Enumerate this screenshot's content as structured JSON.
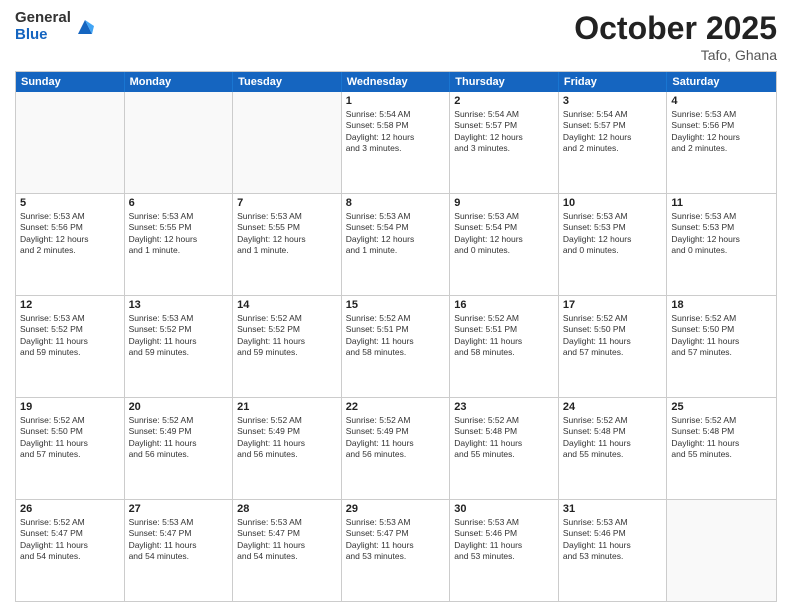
{
  "logo": {
    "general": "General",
    "blue": "Blue"
  },
  "header": {
    "month": "October 2025",
    "location": "Tafo, Ghana"
  },
  "weekdays": [
    "Sunday",
    "Monday",
    "Tuesday",
    "Wednesday",
    "Thursday",
    "Friday",
    "Saturday"
  ],
  "rows": [
    [
      {
        "day": "",
        "empty": true
      },
      {
        "day": "",
        "empty": true
      },
      {
        "day": "",
        "empty": true
      },
      {
        "day": "1",
        "info": "Sunrise: 5:54 AM\nSunset: 5:58 PM\nDaylight: 12 hours\nand 3 minutes."
      },
      {
        "day": "2",
        "info": "Sunrise: 5:54 AM\nSunset: 5:57 PM\nDaylight: 12 hours\nand 3 minutes."
      },
      {
        "day": "3",
        "info": "Sunrise: 5:54 AM\nSunset: 5:57 PM\nDaylight: 12 hours\nand 2 minutes."
      },
      {
        "day": "4",
        "info": "Sunrise: 5:53 AM\nSunset: 5:56 PM\nDaylight: 12 hours\nand 2 minutes."
      }
    ],
    [
      {
        "day": "5",
        "info": "Sunrise: 5:53 AM\nSunset: 5:56 PM\nDaylight: 12 hours\nand 2 minutes."
      },
      {
        "day": "6",
        "info": "Sunrise: 5:53 AM\nSunset: 5:55 PM\nDaylight: 12 hours\nand 1 minute."
      },
      {
        "day": "7",
        "info": "Sunrise: 5:53 AM\nSunset: 5:55 PM\nDaylight: 12 hours\nand 1 minute."
      },
      {
        "day": "8",
        "info": "Sunrise: 5:53 AM\nSunset: 5:54 PM\nDaylight: 12 hours\nand 1 minute."
      },
      {
        "day": "9",
        "info": "Sunrise: 5:53 AM\nSunset: 5:54 PM\nDaylight: 12 hours\nand 0 minutes."
      },
      {
        "day": "10",
        "info": "Sunrise: 5:53 AM\nSunset: 5:53 PM\nDaylight: 12 hours\nand 0 minutes."
      },
      {
        "day": "11",
        "info": "Sunrise: 5:53 AM\nSunset: 5:53 PM\nDaylight: 12 hours\nand 0 minutes."
      }
    ],
    [
      {
        "day": "12",
        "info": "Sunrise: 5:53 AM\nSunset: 5:52 PM\nDaylight: 11 hours\nand 59 minutes."
      },
      {
        "day": "13",
        "info": "Sunrise: 5:53 AM\nSunset: 5:52 PM\nDaylight: 11 hours\nand 59 minutes."
      },
      {
        "day": "14",
        "info": "Sunrise: 5:52 AM\nSunset: 5:52 PM\nDaylight: 11 hours\nand 59 minutes."
      },
      {
        "day": "15",
        "info": "Sunrise: 5:52 AM\nSunset: 5:51 PM\nDaylight: 11 hours\nand 58 minutes."
      },
      {
        "day": "16",
        "info": "Sunrise: 5:52 AM\nSunset: 5:51 PM\nDaylight: 11 hours\nand 58 minutes."
      },
      {
        "day": "17",
        "info": "Sunrise: 5:52 AM\nSunset: 5:50 PM\nDaylight: 11 hours\nand 57 minutes."
      },
      {
        "day": "18",
        "info": "Sunrise: 5:52 AM\nSunset: 5:50 PM\nDaylight: 11 hours\nand 57 minutes."
      }
    ],
    [
      {
        "day": "19",
        "info": "Sunrise: 5:52 AM\nSunset: 5:50 PM\nDaylight: 11 hours\nand 57 minutes."
      },
      {
        "day": "20",
        "info": "Sunrise: 5:52 AM\nSunset: 5:49 PM\nDaylight: 11 hours\nand 56 minutes."
      },
      {
        "day": "21",
        "info": "Sunrise: 5:52 AM\nSunset: 5:49 PM\nDaylight: 11 hours\nand 56 minutes."
      },
      {
        "day": "22",
        "info": "Sunrise: 5:52 AM\nSunset: 5:49 PM\nDaylight: 11 hours\nand 56 minutes."
      },
      {
        "day": "23",
        "info": "Sunrise: 5:52 AM\nSunset: 5:48 PM\nDaylight: 11 hours\nand 55 minutes."
      },
      {
        "day": "24",
        "info": "Sunrise: 5:52 AM\nSunset: 5:48 PM\nDaylight: 11 hours\nand 55 minutes."
      },
      {
        "day": "25",
        "info": "Sunrise: 5:52 AM\nSunset: 5:48 PM\nDaylight: 11 hours\nand 55 minutes."
      }
    ],
    [
      {
        "day": "26",
        "info": "Sunrise: 5:52 AM\nSunset: 5:47 PM\nDaylight: 11 hours\nand 54 minutes."
      },
      {
        "day": "27",
        "info": "Sunrise: 5:53 AM\nSunset: 5:47 PM\nDaylight: 11 hours\nand 54 minutes."
      },
      {
        "day": "28",
        "info": "Sunrise: 5:53 AM\nSunset: 5:47 PM\nDaylight: 11 hours\nand 54 minutes."
      },
      {
        "day": "29",
        "info": "Sunrise: 5:53 AM\nSunset: 5:47 PM\nDaylight: 11 hours\nand 53 minutes."
      },
      {
        "day": "30",
        "info": "Sunrise: 5:53 AM\nSunset: 5:46 PM\nDaylight: 11 hours\nand 53 minutes."
      },
      {
        "day": "31",
        "info": "Sunrise: 5:53 AM\nSunset: 5:46 PM\nDaylight: 11 hours\nand 53 minutes."
      },
      {
        "day": "",
        "empty": true
      }
    ]
  ]
}
